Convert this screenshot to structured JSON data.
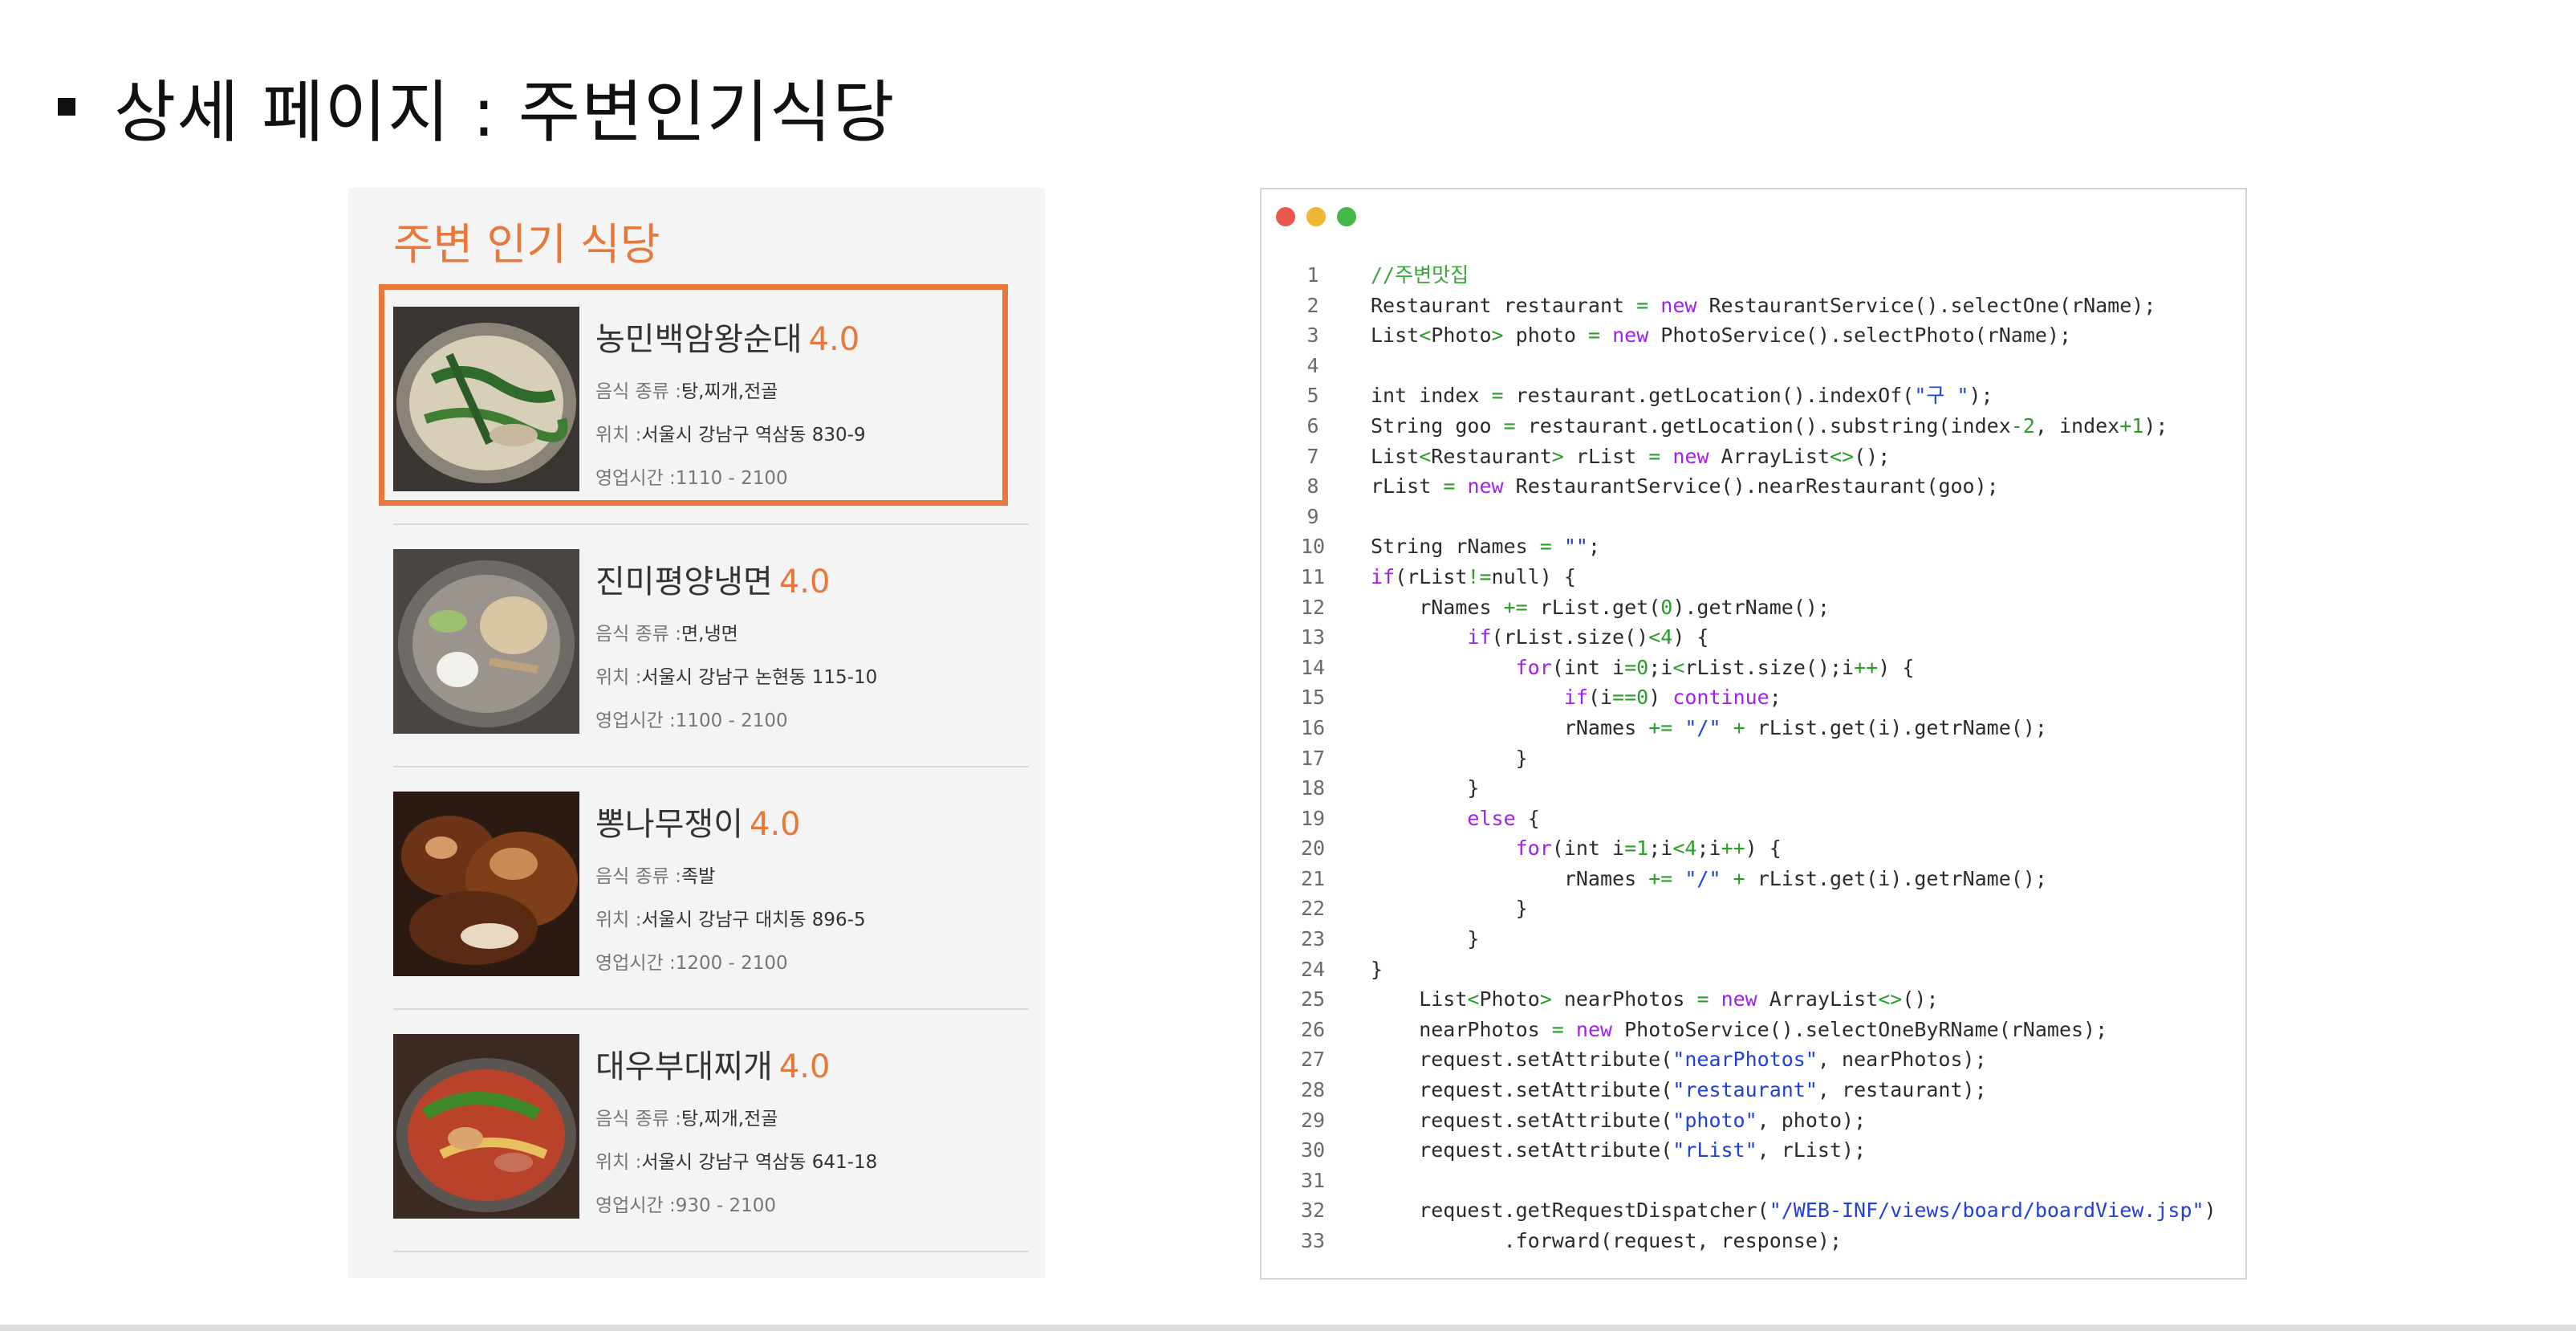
{
  "heading": {
    "text": "상세 페이지 : 주변인기식당"
  },
  "panel": {
    "title": "주변 인기 식당",
    "type_label": "음식 종류 :",
    "loc_label": "위치 :",
    "hours_label": "영업시간 :",
    "items": [
      {
        "name": "농민백암왕순대",
        "rating": "4.0",
        "type": "탕,찌개,전골",
        "location": "서울시 강남구 역삼동 830-9",
        "hours": "1110 - 2100",
        "selected": true,
        "photo_icon": "soup-photo"
      },
      {
        "name": "진미평양냉면",
        "rating": "4.0",
        "type": "면,냉면",
        "location": "서울시 강남구 논현동 115-10",
        "hours": "1100 - 2100",
        "selected": false,
        "photo_icon": "cold-noodle-photo"
      },
      {
        "name": "뽕나무쟁이",
        "rating": "4.0",
        "type": "족발",
        "location": "서울시 강남구 대치동 896-5",
        "hours": "1200 - 2100",
        "selected": false,
        "photo_icon": "pork-trotter-photo"
      },
      {
        "name": "대우부대찌개",
        "rating": "4.0",
        "type": "탕,찌개,전골",
        "location": "서울시 강남구 역삼동 641-18",
        "hours": "930 - 2100",
        "selected": false,
        "photo_icon": "stew-photo"
      }
    ]
  },
  "code_window": {
    "dot_colors": [
      "#e8584f",
      "#f0b733",
      "#45b84a"
    ],
    "line_numbers": [
      "1",
      "2",
      "3",
      "4",
      "5",
      "6",
      "7",
      "8",
      "9",
      "10",
      "11",
      "12",
      "13",
      "14",
      "15",
      "16",
      "17",
      "18",
      "19",
      "20",
      "21",
      "22",
      "23",
      "24",
      "25",
      "26",
      "27",
      "28",
      "29",
      "30",
      "31",
      "32",
      "33"
    ],
    "lines": [
      "//주변맛집",
      "Restaurant restaurant = new RestaurantService().selectOne(rName);",
      "List<Photo> photo = new PhotoService().selectPhoto(rName);",
      "",
      "int index = restaurant.getLocation().indexOf(\"구 \");",
      "String goo = restaurant.getLocation().substring(index-2, index+1);",
      "List<Restaurant> rList = new ArrayList<>();",
      "rList = new RestaurantService().nearRestaurant(goo);",
      "",
      "String rNames = \"\";",
      "if(rList!=null) {",
      "    rNames += rList.get(0).getrName();",
      "        if(rList.size()<4) {",
      "            for(int i=0;i<rList.size();i++) {",
      "                if(i==0) continue;",
      "                rNames += \"/\" + rList.get(i).getrName();",
      "            }",
      "        }",
      "        else {",
      "            for(int i=1;i<4;i++) {",
      "                rNames += \"/\" + rList.get(i).getrName();",
      "            }",
      "        }",
      "}",
      "    List<Photo> nearPhotos = new ArrayList<>();",
      "    nearPhotos = new PhotoService().selectOneByRName(rNames);",
      "    request.setAttribute(\"nearPhotos\", nearPhotos);",
      "    request.setAttribute(\"restaurant\", restaurant);",
      "    request.setAttribute(\"photo\", photo);",
      "    request.setAttribute(\"rList\", rList);",
      "",
      "    request.getRequestDispatcher(\"/WEB-INF/views/board/boardView.jsp\")",
      "           .forward(request, response);"
    ]
  },
  "colors": {
    "accent": "#e8783a",
    "keyword": "#a020f0",
    "string": "#2040d8",
    "number": "#2a9d2a"
  }
}
